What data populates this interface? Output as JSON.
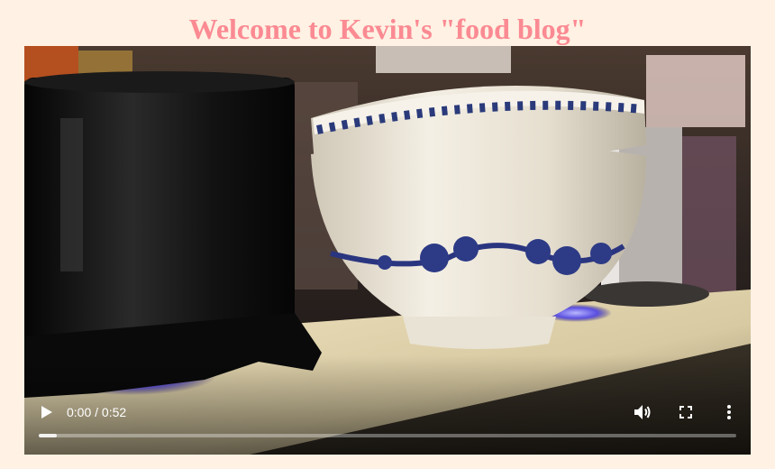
{
  "page": {
    "title": "Welcome to Kevin's \"food blog\""
  },
  "video": {
    "current_time": "0:00",
    "duration": "0:52",
    "buffered_fraction": 0.026,
    "icons": {
      "play": "play-icon",
      "volume": "volume-icon",
      "fullscreen": "fullscreen-icon",
      "more": "more-vertical-icon"
    }
  },
  "colors": {
    "page_background": "#fff1e3",
    "title": "#fb8a93"
  }
}
